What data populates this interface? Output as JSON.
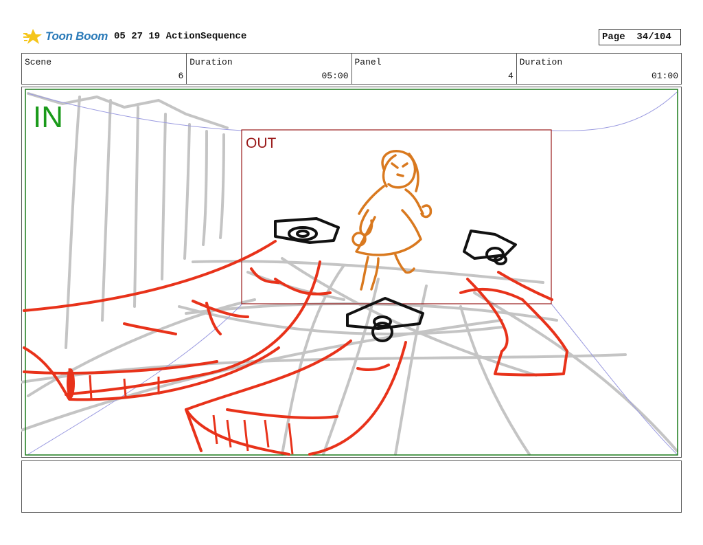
{
  "header": {
    "logo_text": "Toon Boom",
    "title": "05 27 19 ActionSequence",
    "page": "Page  34/104"
  },
  "info": [
    {
      "label": "Scene",
      "value": "6"
    },
    {
      "label": "Duration",
      "value": "05:00"
    },
    {
      "label": "Panel",
      "value": "4"
    },
    {
      "label": "Duration",
      "value": "01:00"
    }
  ],
  "panel": {
    "in_label": "IN",
    "out_label": "OUT",
    "colors": {
      "in_frame": "#1a7a1a",
      "out_frame": "#9a1a1a",
      "background_lines": "#c4c4c4",
      "red_sketch": "#e8321a",
      "character": "#d9791f",
      "props": "#111111",
      "camera_guides": "#9a9ae0"
    }
  },
  "notes": {
    "text": ""
  }
}
